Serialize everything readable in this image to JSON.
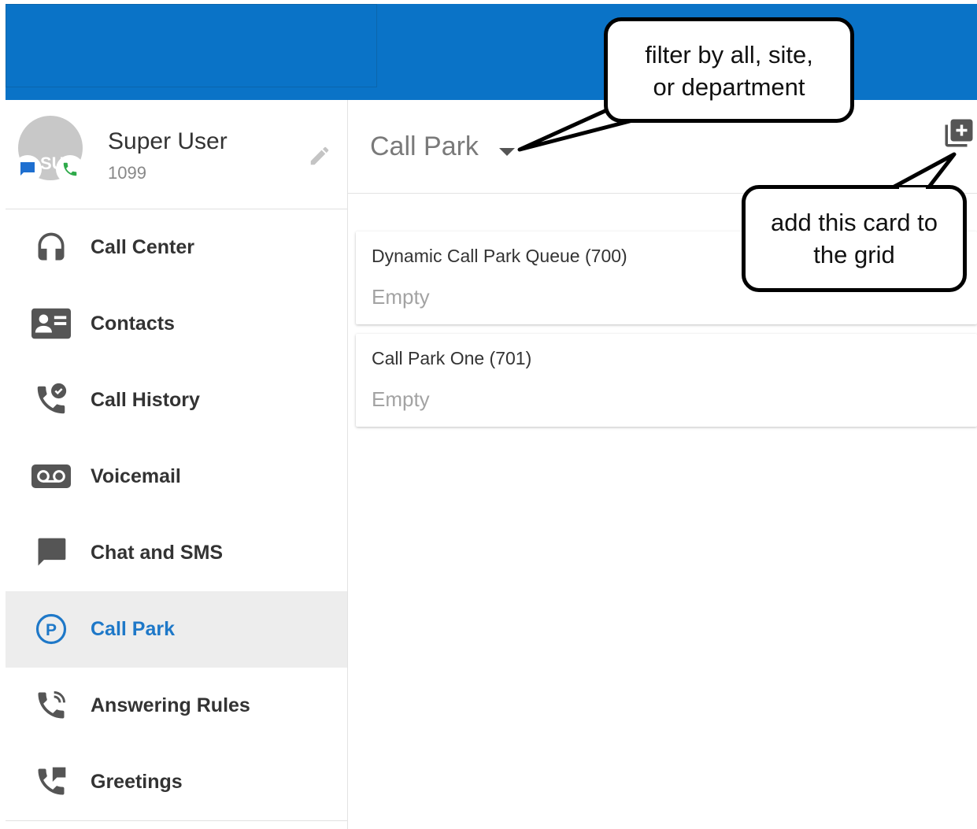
{
  "user": {
    "name": "Super User",
    "extension": "1099",
    "initials": "SU"
  },
  "nav": [
    {
      "label": "Call Center",
      "icon": "headset-icon"
    },
    {
      "label": "Contacts",
      "icon": "contact-card-icon"
    },
    {
      "label": "Call History",
      "icon": "call-history-icon"
    },
    {
      "label": "Voicemail",
      "icon": "voicemail-icon"
    },
    {
      "label": "Chat and SMS",
      "icon": "chat-icon"
    },
    {
      "label": "Call Park",
      "icon": "parking-icon",
      "active": true
    },
    {
      "label": "Answering Rules",
      "icon": "answering-rules-icon"
    },
    {
      "label": "Greetings",
      "icon": "greetings-icon"
    }
  ],
  "main": {
    "title": "Call Park"
  },
  "cards": [
    {
      "name": "Dynamic Call Park Queue (700)",
      "status": "Empty"
    },
    {
      "name": "Call Park One (701)",
      "status": "Empty"
    }
  ],
  "callouts": {
    "filter_line1": "filter by all, site,",
    "filter_line2": "or department",
    "add_line1": "add this card to",
    "add_line2": "the grid"
  },
  "colors": {
    "header": "#0a73c7",
    "active_text": "#1e78c8",
    "active_bg": "#ededed"
  }
}
